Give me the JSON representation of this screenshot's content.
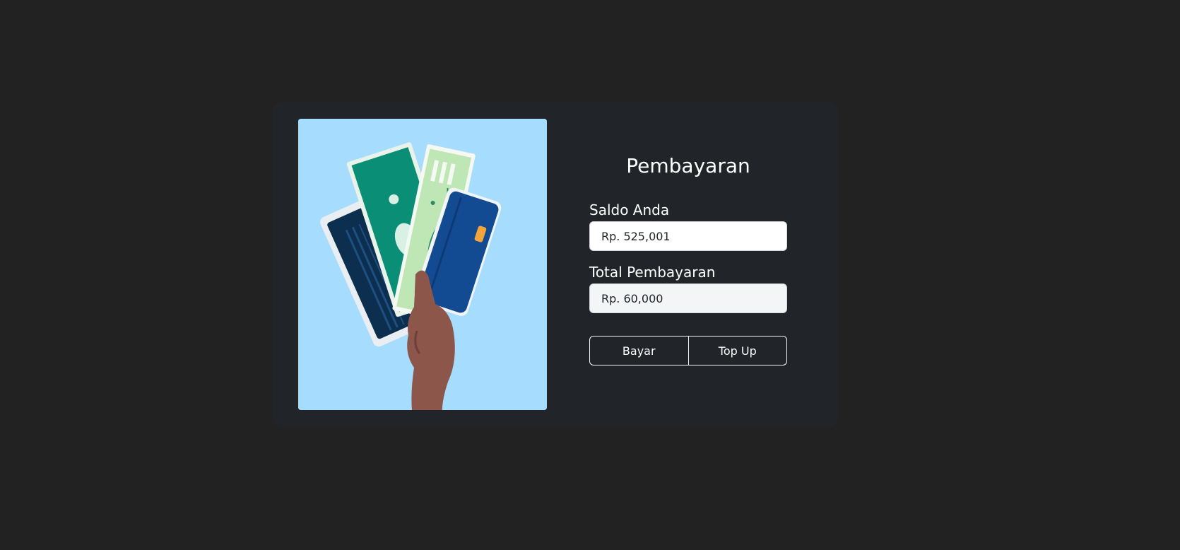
{
  "page": {
    "title": "Pembayaran"
  },
  "balance": {
    "label": "Saldo Anda",
    "value": "Rp. 525,001"
  },
  "payment": {
    "label": "Total Pembayaran",
    "value": "Rp. 60,000"
  },
  "actions": {
    "pay_label": "Bayar",
    "topup_label": "Top Up"
  },
  "colors": {
    "background": "#222222",
    "card": "#212529",
    "illustration_bg": "#a6dcfe"
  },
  "illustration": {
    "icon": "hand-holding-cards-and-cash-illustration"
  }
}
